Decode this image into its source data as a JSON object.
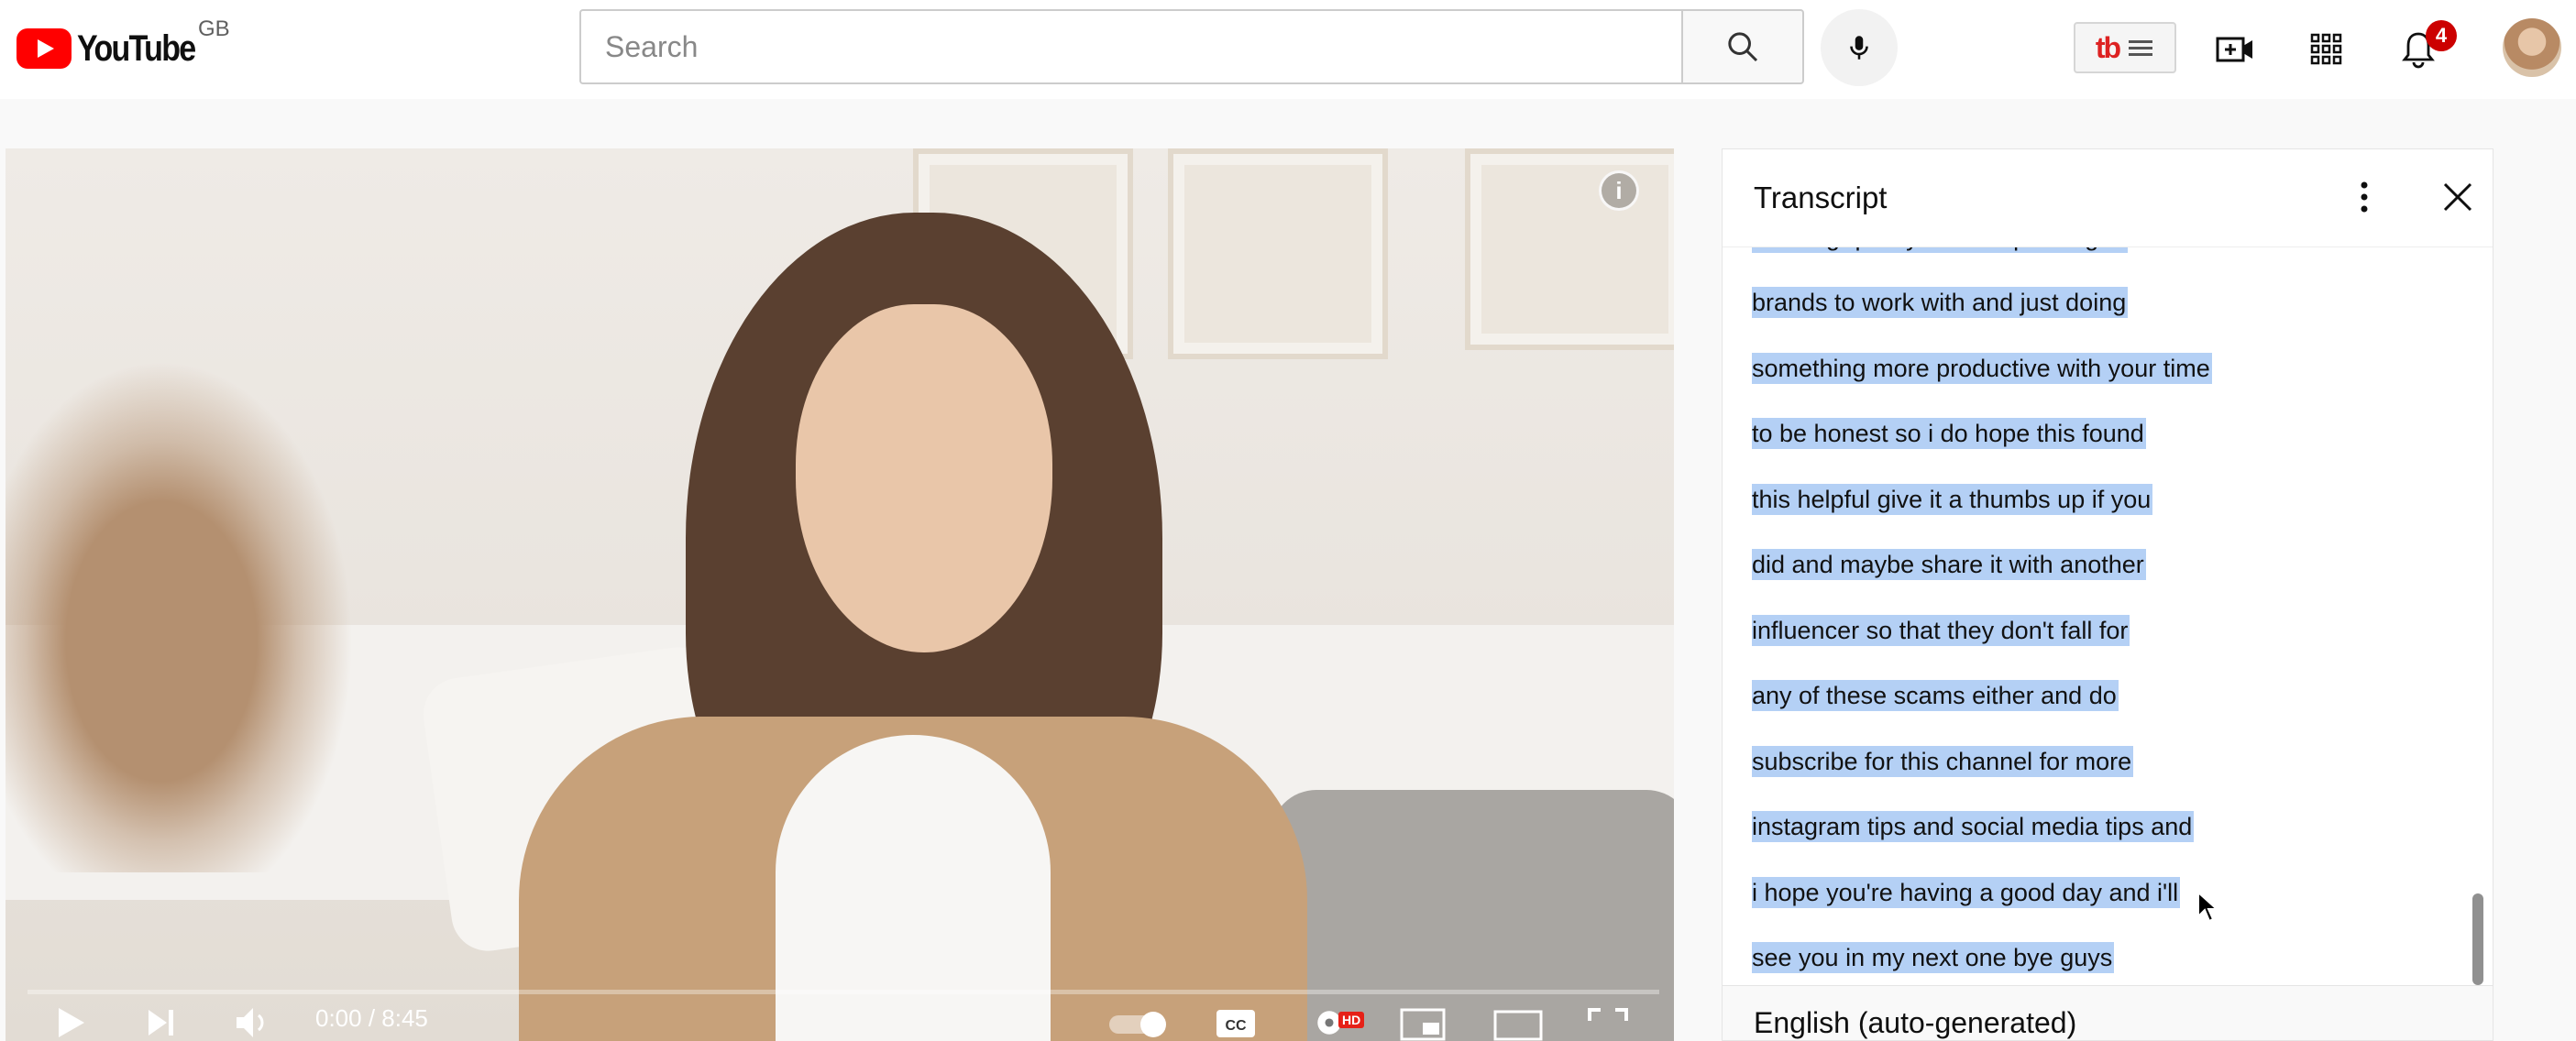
{
  "header": {
    "logo_text": "YouTube",
    "region": "GB",
    "search_placeholder": "Search",
    "tb_extension_logo": "tb",
    "notification_count": "4",
    "icons": [
      "search-icon",
      "mic-icon",
      "create-video-icon",
      "apps-grid-icon",
      "notifications-bell-icon",
      "avatar"
    ]
  },
  "player": {
    "time": "0:00 / 8:45",
    "progress_fraction": 0.0,
    "info_label": "i",
    "hd_label": "HD",
    "cc_label": "CC"
  },
  "transcript": {
    "title": "Transcript",
    "segments": [
      "creating quality content pitching to",
      "brands to work with and just doing",
      "something more productive with your time",
      "to be honest so i do hope this found",
      "this helpful give it a thumbs up if you",
      "did and maybe share it with another",
      "influencer so that they don't fall for",
      "any of these scams either and do",
      "subscribe for this channel for more",
      "instagram tips and social media tips and",
      "i hope you're having a good day and i'll",
      "see you in my next one bye guys"
    ],
    "language": "English (auto-generated)",
    "selection_color": "#b4d0f5"
  },
  "colors": {
    "brand_red": "#ff0000",
    "badge_red": "#cc0000"
  }
}
